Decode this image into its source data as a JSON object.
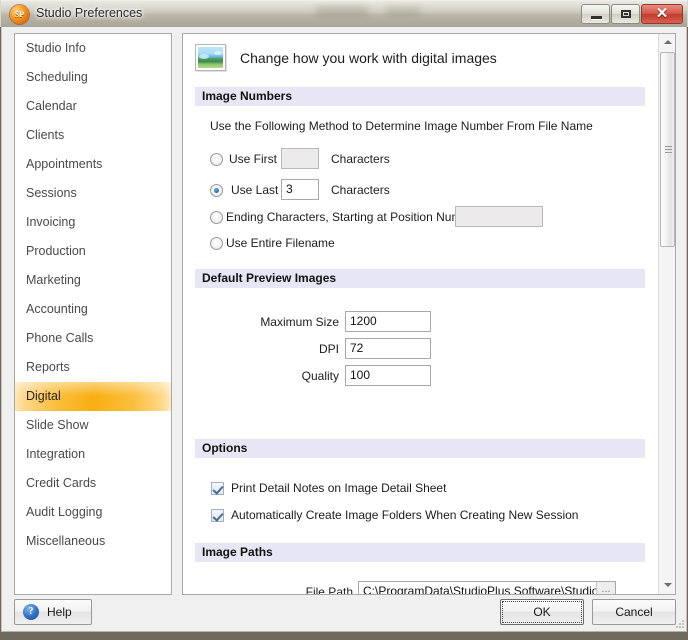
{
  "window": {
    "title": "Studio Preferences",
    "app_icon": "SP",
    "minimize_label": "Minimize",
    "maximize_label": "Maximize",
    "close_label": "✕"
  },
  "sidebar": {
    "items": [
      {
        "label": "Studio Info",
        "selected": false
      },
      {
        "label": "Scheduling",
        "selected": false
      },
      {
        "label": "Calendar",
        "selected": false
      },
      {
        "label": "Clients",
        "selected": false
      },
      {
        "label": "Appointments",
        "selected": false
      },
      {
        "label": "Sessions",
        "selected": false
      },
      {
        "label": "Invoicing",
        "selected": false
      },
      {
        "label": "Production",
        "selected": false
      },
      {
        "label": "Marketing",
        "selected": false
      },
      {
        "label": "Accounting",
        "selected": false
      },
      {
        "label": "Phone Calls",
        "selected": false
      },
      {
        "label": "Reports",
        "selected": false
      },
      {
        "label": "Digital",
        "selected": true
      },
      {
        "label": "Slide Show",
        "selected": false
      },
      {
        "label": "Integration",
        "selected": false
      },
      {
        "label": "Credit Cards",
        "selected": false
      },
      {
        "label": "Audit Logging",
        "selected": false
      },
      {
        "label": "Miscellaneous",
        "selected": false
      }
    ],
    "selected_item": "Digital",
    "selected_accent": "#f9ae12"
  },
  "content": {
    "header": {
      "icon": "picture-icon",
      "title": "Change how you work with digital images"
    },
    "image_numbers": {
      "section_title": "Image Numbers",
      "instruction": "Use the Following Method to Determine Image Number From File Name",
      "options": [
        {
          "label_before": "Use First",
          "label_after": "Characters",
          "value": "",
          "selected": false,
          "field_enabled": false
        },
        {
          "label_before": "Use Last",
          "label_after": "Characters",
          "value": "3",
          "selected": true,
          "field_enabled": true
        },
        {
          "label_before": "Ending Characters, Starting at Position Number",
          "label_after": "",
          "value": "",
          "selected": false,
          "field_enabled": false
        },
        {
          "label_before": "Use Entire Filename",
          "label_after": "",
          "value": null,
          "selected": false,
          "field_enabled": false
        }
      ]
    },
    "default_preview_images": {
      "section_title": "Default Preview Images",
      "fields": [
        {
          "label": "Maximum Size",
          "value": "1200"
        },
        {
          "label": "DPI",
          "value": "72"
        },
        {
          "label": "Quality",
          "value": "100"
        }
      ]
    },
    "options": {
      "section_title": "Options",
      "checkboxes": [
        {
          "label": "Print Detail Notes on Image Detail Sheet",
          "checked": true
        },
        {
          "label": "Automatically Create Image Folders When Creating New Session",
          "checked": true
        }
      ]
    },
    "image_paths": {
      "section_title": "Image Paths",
      "file_path_label": "File Path",
      "file_path_value": "C:\\ProgramData\\StudioPlus Software\\StudioPlu",
      "browse_label": "..."
    },
    "scrollbar": {
      "up_arrow": "scroll-up",
      "down_arrow": "scroll-down"
    }
  },
  "footer": {
    "help_label": "Help",
    "help_icon": "?",
    "ok_label": "OK",
    "cancel_label": "Cancel"
  }
}
